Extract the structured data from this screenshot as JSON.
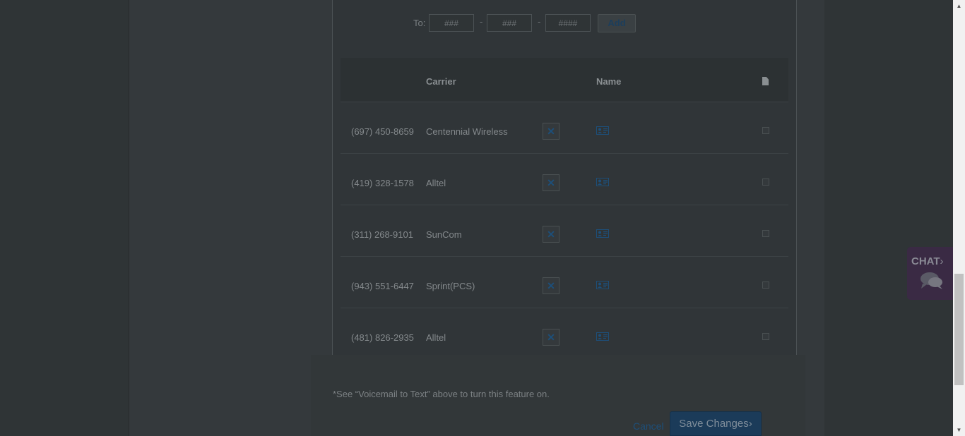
{
  "form": {
    "to_label": "To:",
    "segment_placeholders": [
      "###",
      "###",
      "####"
    ],
    "dash": "-",
    "add_label": "Add"
  },
  "table": {
    "columns": {
      "carrier": "Carrier",
      "name": "Name"
    },
    "rows": [
      {
        "number": "(697) 450-8659",
        "carrier": "Centennial Wireless"
      },
      {
        "number": "(419) 328-1578",
        "carrier": "Alltel"
      },
      {
        "number": "(311) 268-9101",
        "carrier": "SunCom"
      },
      {
        "number": "(943) 551-6447",
        "carrier": "Sprint(PCS)"
      },
      {
        "number": "(481) 826-2935",
        "carrier": "Alltel"
      }
    ],
    "remove_glyph": "✕",
    "icons": {
      "header": "document-icon",
      "row_name": "contact-card-icon",
      "remove": "close-icon"
    }
  },
  "footer": {
    "note": "*See “Voicemail to Text” above to turn this feature on.",
    "cancel_label": "Cancel",
    "save_label": "Save Changes",
    "save_chevron": "›"
  },
  "chat": {
    "label": "CHAT",
    "chevron": "›"
  },
  "scrollbar": {
    "up": "▲",
    "down": "▼"
  },
  "colors": {
    "overlay_bg": "#2f3436",
    "accent": "#1d4f7a",
    "save_bg": "#1b3b59",
    "chat_bg": "#3a2a44"
  }
}
